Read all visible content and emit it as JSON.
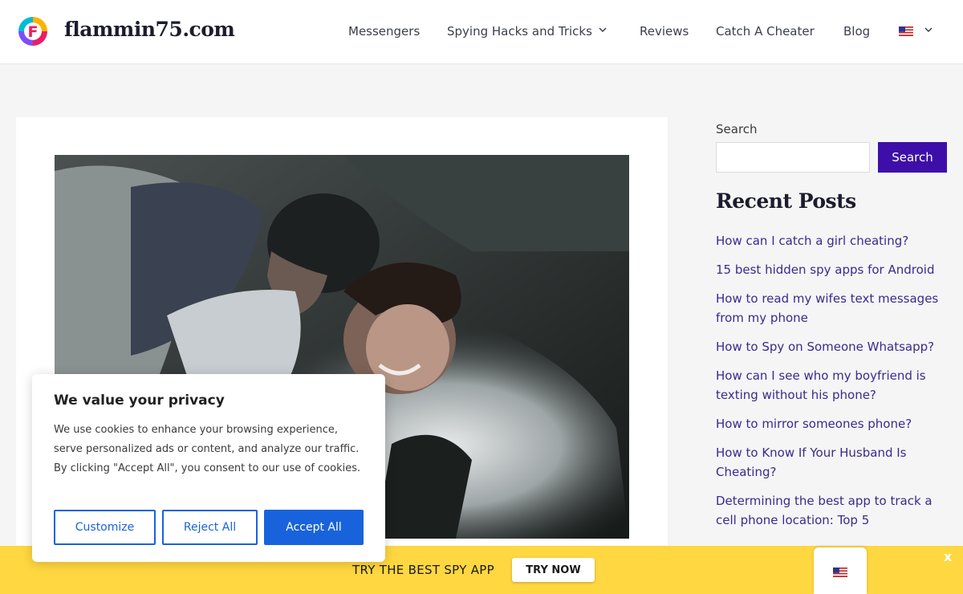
{
  "header": {
    "site_title": "flammin75.com",
    "logo_letter": "F",
    "nav": [
      {
        "label": "Messengers"
      },
      {
        "label": "Spying Hacks and Tricks"
      },
      {
        "label": "Reviews"
      },
      {
        "label": "Catch A Cheater"
      },
      {
        "label": "Blog"
      }
    ]
  },
  "sidebar": {
    "search_label": "Search",
    "search_value": "",
    "search_button": "Search",
    "recent_title": "Recent Posts",
    "posts": [
      "How can I catch a girl cheating?",
      "15 best hidden spy apps for Android",
      "How to read my wifes text messages from my phone",
      "How to Spy on Someone Whatsapp?",
      "How can I see who my boyfriend is texting without his phone?",
      "How to mirror someones phone?",
      "How to Know If Your Husband Is Cheating?",
      "Determining the best app to track a cell phone location: Top 5"
    ]
  },
  "cookie": {
    "title": "We value your privacy",
    "text": "We use cookies to enhance your browsing experience, serve personalized ads or content, and analyze our traffic. By clicking \"Accept All\", you consent to our use of cookies.",
    "customize": "Customize",
    "reject": "Reject All",
    "accept": "Accept All"
  },
  "banner": {
    "text": "TRY THE BEST SPY APP",
    "button": "TRY NOW",
    "close": "x"
  },
  "colors": {
    "brand_purple": "#3d0fa8",
    "link": "#3b2a8f",
    "cookie_blue": "#1863dc",
    "banner_yellow": "#ffd740"
  },
  "icons": {
    "logo": "flammin-logo-icon",
    "flag": "us-flag-icon",
    "chevron": "chevron-down-icon"
  }
}
